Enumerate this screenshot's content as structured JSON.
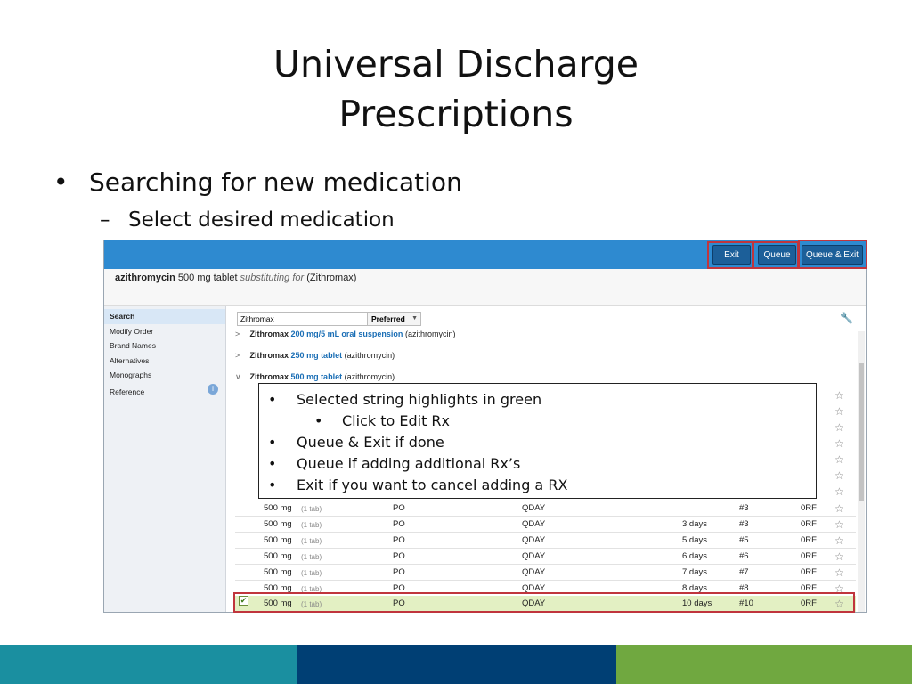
{
  "slide": {
    "title_line1": "Universal Discharge",
    "title_line2": "Prescriptions",
    "bullet": "Searching for new medication",
    "sub_bullet": "Select desired medication"
  },
  "app": {
    "toolbar": {
      "exit": "Exit",
      "queue": "Queue",
      "queue_exit": "Queue & Exit"
    },
    "header": {
      "drug": "azithromycin",
      "rest": "500 mg tablet",
      "sub": "substituting for",
      "orig": "(Zithromax)"
    },
    "nav": [
      "Search",
      "Modify Order",
      "Brand Names",
      "Alternatives",
      "Monographs",
      "Reference"
    ],
    "search": {
      "value": "Zithromax",
      "filter": "Preferred"
    },
    "results": [
      {
        "chev": ">",
        "brand": "Zithromax",
        "strength": "200 mg/5 mL oral suspension",
        "generic": "(azithromycin)"
      },
      {
        "chev": ">",
        "brand": "Zithromax",
        "strength": "250 mg tablet",
        "generic": "(azithromycin)"
      },
      {
        "chev": "∨",
        "brand": "Zithromax",
        "strength": "500 mg tablet",
        "generic": "(azithromycin)"
      }
    ],
    "dose_rows": [
      {
        "dose": "500 mg",
        "unit": "(1 tab)",
        "route": "PO",
        "freq": "QDAY",
        "duration": "",
        "qty": "#3",
        "refills": "0RF"
      },
      {
        "dose": "500 mg",
        "unit": "(1 tab)",
        "route": "PO",
        "freq": "QDAY",
        "duration": "3 days",
        "qty": "#3",
        "refills": "0RF"
      },
      {
        "dose": "500 mg",
        "unit": "(1 tab)",
        "route": "PO",
        "freq": "QDAY",
        "duration": "5 days",
        "qty": "#5",
        "refills": "0RF"
      },
      {
        "dose": "500 mg",
        "unit": "(1 tab)",
        "route": "PO",
        "freq": "QDAY",
        "duration": "6 days",
        "qty": "#6",
        "refills": "0RF"
      },
      {
        "dose": "500 mg",
        "unit": "(1 tab)",
        "route": "PO",
        "freq": "QDAY",
        "duration": "7 days",
        "qty": "#7",
        "refills": "0RF"
      },
      {
        "dose": "500 mg",
        "unit": "(1 tab)",
        "route": "PO",
        "freq": "QDAY",
        "duration": "8 days",
        "qty": "#8",
        "refills": "0RF"
      },
      {
        "dose": "500 mg",
        "unit": "(1 tab)",
        "route": "PO",
        "freq": "QDAY",
        "duration": "10 days",
        "qty": "#10",
        "refills": "0RF",
        "selected": true
      }
    ]
  },
  "callout": {
    "l1": "Selected string highlights in green",
    "l2": "Click to Edit Rx",
    "l3": "Queue & Exit if done",
    "l4": "Queue if adding additional Rx’s",
    "l5": "Exit if you want to cancel adding a RX"
  },
  "colors": {
    "topbar": "#2e8ad0",
    "highlight_border": "#c0353d",
    "selected_row": "#e3f0c3",
    "footer": [
      "#1a8fa0",
      "#003f74",
      "#70a840"
    ]
  }
}
